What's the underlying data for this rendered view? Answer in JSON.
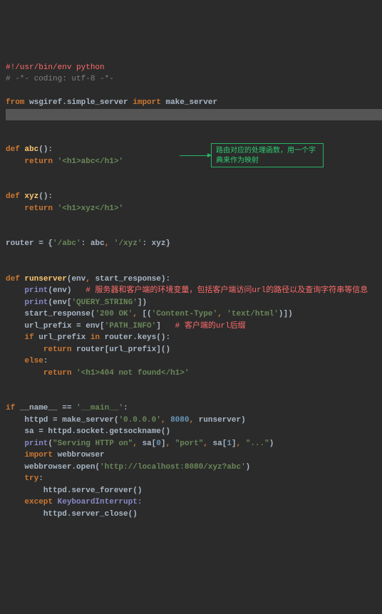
{
  "lines": {
    "shebang": "#!/usr/bin/env python",
    "coding": "# -*- coding: utf-8 -*-",
    "from_kw": "from",
    "import_mod": "wsgiref.simple_server",
    "import_kw": "import",
    "import_name": "make_server",
    "def_kw": "def",
    "abc_name": "abc",
    "abc_return": "return",
    "abc_str": "'<h1>abc</h1>'",
    "xyz_name": "xyz",
    "xyz_return": "return",
    "xyz_str": "'<h1>xyz</h1>'",
    "router_var": "router = {",
    "router_key1": "'/abc'",
    "router_val1": ": abc",
    "router_key2": "'/xyz'",
    "router_val2": ": xyz}",
    "runserver_name": "runserver",
    "runserver_args": "(env",
    "runserver_args2": "start_response):",
    "print_env": "print",
    "env_arg": "(env)   ",
    "env_comment": "# 服务器和客户端的环境变量，包括客户端访问url的路径以及查询字符串等信息",
    "print_qs": "print",
    "qs_arg_open": "(env[",
    "qs_key": "'QUERY_STRING'",
    "qs_arg_close": "])",
    "start_resp": "start_response(",
    "ok_str": "'200 OK'",
    "ct_list": "[(",
    "ct_key": "'Content-Type'",
    "ct_val": "'text/html'",
    "ct_close": ")])",
    "urlprefix_var": "url_prefix = env[",
    "pathinfo": "'PATH_INFO'",
    "urlprefix_close": "]   ",
    "urlprefix_comment": "# 客户端的url后缀",
    "if_kw": "if",
    "if_cond_a": " url_prefix ",
    "in_kw": "in",
    "if_cond_b": " router.keys():",
    "ret_router": "return",
    "router_call": " router[url_prefix]()",
    "else_kw": "else",
    "ret_404": "return",
    "str_404": "'<h1>404 not found</h1>'",
    "if_name": "if",
    "name_var": " __name__ == ",
    "main_str": "'__main__'",
    "httpd_make": "httpd = make_server(",
    "host_str": "'0.0.0.0'",
    "port_num": "8080",
    "runserver_ref": "runserver)",
    "sa_line": "sa = httpd.socket.getsockname()",
    "print_serving": "print",
    "serving_open": "(",
    "serving_str": "\"Serving HTTP on\"",
    "sa0": "sa[",
    "idx0": "0",
    "sa0_close": "]",
    "port_str": "\"port\"",
    "sa1": "sa[",
    "idx1": "1",
    "sa1_close": "]",
    "dots": "\"...\"",
    "serving_close": ")",
    "import_wb": "import",
    "wb_mod": " webbrowser",
    "wb_open": "webbrowser.open(",
    "wb_url": "'http://localhost:8080/xyz?abc'",
    "wb_close": ")",
    "try_kw": "try",
    "serve_forever": "httpd.serve_forever()",
    "except_kw": "except",
    "kbi": " KeyboardInterrupt:",
    "server_close": "httpd.server_close()"
  },
  "callout": {
    "text": "路由对应的处理函数，用一个字典来作为映射"
  }
}
